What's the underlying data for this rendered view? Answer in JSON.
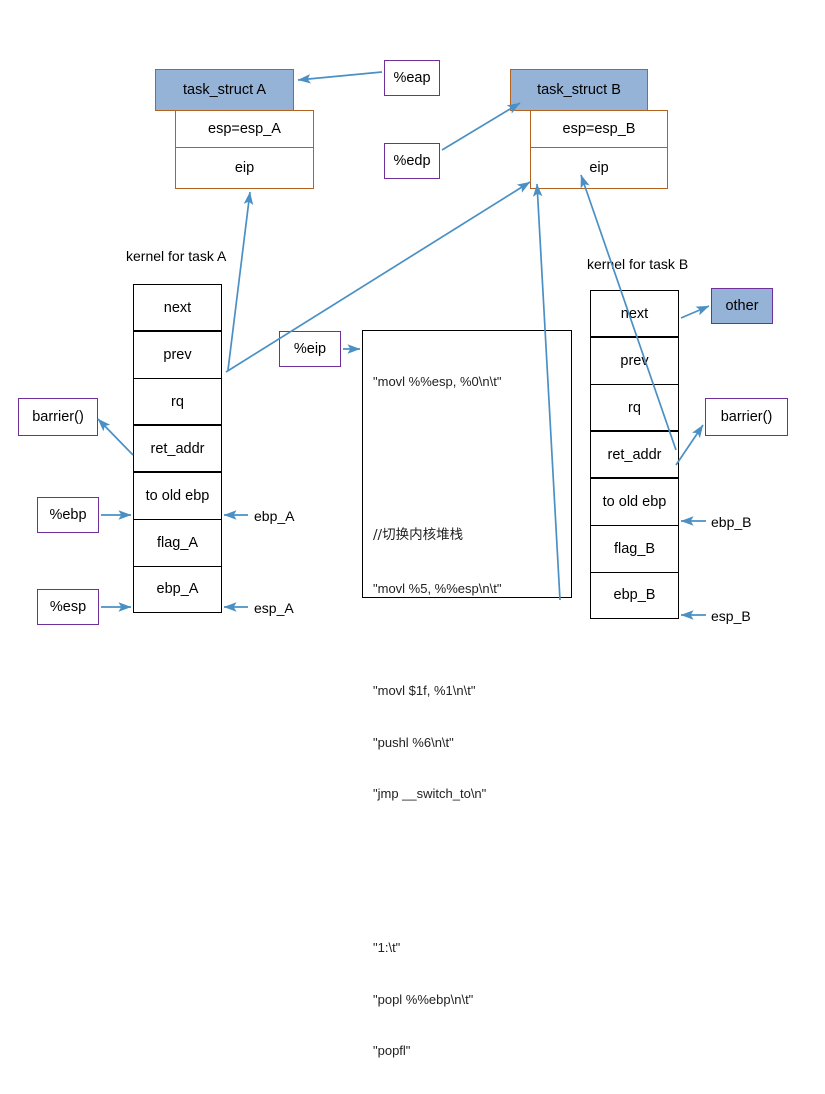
{
  "diagram": {
    "title": "Linux context switch: switch_to between task A and task B",
    "colors": {
      "header_fill": "#95b3d7",
      "header_border": "#b4621f",
      "reg_border": "#70309a",
      "arrow": "#4a90c4",
      "stack_border": "#000000"
    }
  },
  "task_struct_a": {
    "header": "task_struct A",
    "rows": [
      "esp=esp_A",
      "eip"
    ]
  },
  "task_struct_b": {
    "header": "task_struct B",
    "rows": [
      "esp=esp_B",
      "eip"
    ]
  },
  "registers": {
    "eap": "%eap",
    "edp": "%edp",
    "eip": "%eip",
    "ebp": "%ebp",
    "esp": "%esp"
  },
  "labels": {
    "kernel_a": "kernel for task A",
    "kernel_b": "kernel for task B",
    "barrier_left": "barrier()",
    "barrier_right": "barrier()",
    "other": "other"
  },
  "stack_a": {
    "cells": [
      "next",
      "prev",
      "rq",
      "ret_addr",
      "to old ebp",
      "flag_A",
      "ebp_A"
    ],
    "pointers": {
      "ebp": "ebp_A",
      "esp": "esp_A"
    }
  },
  "stack_b": {
    "cells": [
      "next",
      "prev",
      "rq",
      "ret_addr",
      "to old ebp",
      "flag_B",
      "ebp_B"
    ],
    "pointers": {
      "ebp": "ebp_B",
      "esp": "esp_B"
    }
  },
  "code": {
    "lines": [
      "\"movl %%esp, %0\\n\\t\"",
      "",
      "",
      "//切换内核堆栈",
      "\"movl %5, %%esp\\n\\t\"",
      "",
      "\"movl $1f, %1\\n\\t\"",
      "\"pushl %6\\n\\t\"",
      "\"jmp __switch_to\\n\"",
      "",
      "",
      "\"1:\\t\"",
      "\"popl %%ebp\\n\\t\"",
      "\"popfl\""
    ]
  }
}
